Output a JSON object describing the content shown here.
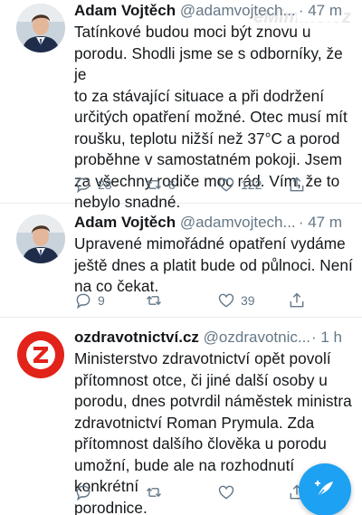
{
  "watermark": "eMimino.cz",
  "tweets": [
    {
      "name": "Adam Vojtěch",
      "handle": "@adamvojtech...",
      "time": "· 47 m",
      "text_lines": [
        "Tatínkové budou moci být znovu u",
        "porodu. Shodli jsme se s odborníky, že je",
        "to za stávající situace a při dodržení",
        "určitých opatření možné. Otec musí mít",
        "roušku, teplotu nižší než 37°C a porod",
        "proběhne v samostatném pokoji. Jsem",
        "za všechny rodiče moc rád. Vím, že to",
        "nebylo snadné."
      ],
      "replies": "28",
      "retweets": "6",
      "likes": "122"
    },
    {
      "name": "Adam Vojtěch",
      "handle": "@adamvojtech...",
      "time": "· 47 m",
      "text_lines": [
        "Upravené mimořádné opatření vydáme",
        "ještě dnes a platit bude od půlnoci. Není",
        "na co čekat."
      ],
      "replies": "9",
      "retweets": "",
      "likes": "39"
    },
    {
      "name": "ozdravotnictví.cz",
      "handle": "@ozdravotnic...",
      "time": "· 1 h",
      "text_lines": [
        "Ministerstvo zdravotnictví opět povolí",
        "přítomnost otce, či jiné další osoby u",
        "porodu, dnes potvrdil náměstek ministra",
        "zdravotnictví Roman Prymula. Zda",
        "přítomnost dalšího člověka u porodu",
        "umožní, bude ale na rozhodnutí konkrétní",
        "porodnice."
      ],
      "replies": "",
      "retweets": "",
      "likes": ""
    }
  ],
  "colors": {
    "accent": "#1da1f2",
    "muted": "#657786",
    "logo_red": "#e2231a"
  },
  "icons": {
    "reply": "reply-icon",
    "retweet": "retweet-icon",
    "like": "heart-icon",
    "share": "share-icon",
    "compose": "compose-feather-icon"
  }
}
